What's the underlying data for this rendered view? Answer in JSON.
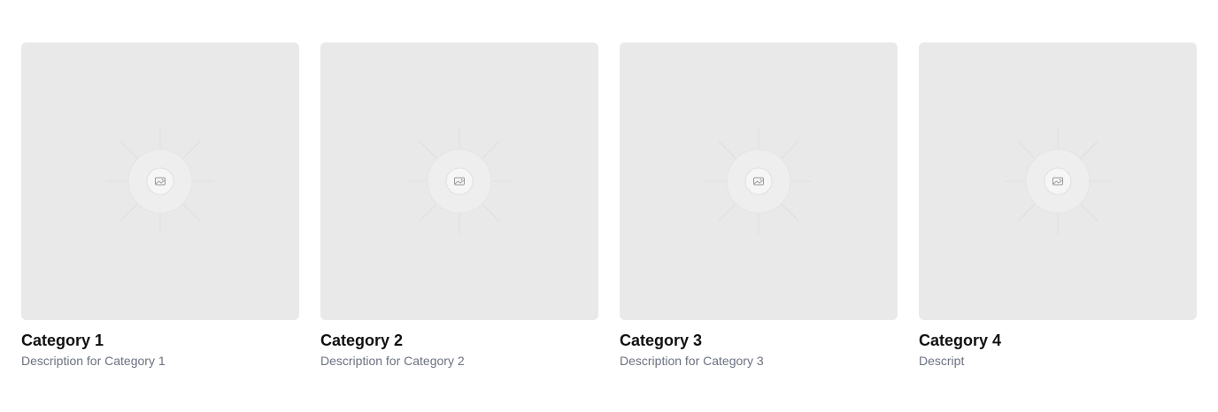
{
  "categories": [
    {
      "title": "Category 1",
      "description": "Description for Category 1",
      "image_icon": "image-placeholder-icon"
    },
    {
      "title": "Category 2",
      "description": "Description for Category 2",
      "image_icon": "image-placeholder-icon"
    },
    {
      "title": "Category 3",
      "description": "Description for Category 3",
      "image_icon": "image-placeholder-icon"
    },
    {
      "title": "Category 4",
      "description": "Descript",
      "image_icon": "image-placeholder-icon"
    }
  ],
  "colors": {
    "thumbnail_bg": "#e9e9e9",
    "title_text": "#111111",
    "description_text": "#6b7280"
  }
}
